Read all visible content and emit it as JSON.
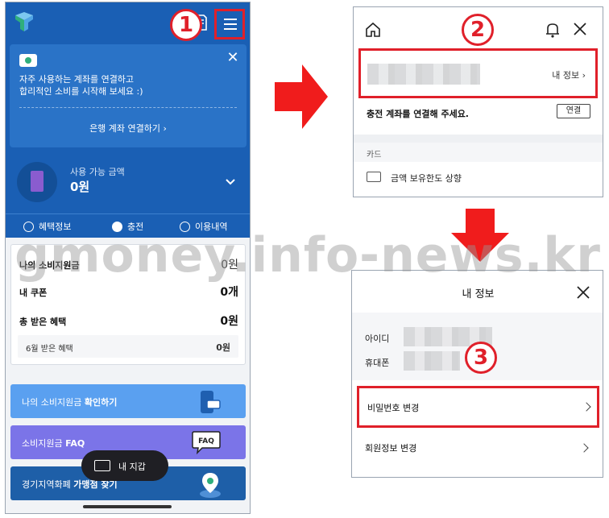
{
  "colors": {
    "brand_blue": "#1a5fb4",
    "highlight_red": "#e0202a",
    "arrow_red": "#f01c1c"
  },
  "steps": {
    "one": "1",
    "two": "2",
    "three": "3"
  },
  "left_phone": {
    "banner": {
      "line1": "자주 사용하는 계좌를 연결하고",
      "line2": "합리적인 소비를 시작해 보세요 :)",
      "link": "은행 계좌 연결하기 ›"
    },
    "balance": {
      "label": "사용 가능 금액",
      "value": "0원"
    },
    "tabs": [
      {
        "label": "혜택정보",
        "icon": "percent-icon"
      },
      {
        "label": "충전",
        "icon": "won-icon"
      },
      {
        "label": "이용내역",
        "icon": "list-icon"
      }
    ],
    "summary": [
      {
        "label": "나의 소비지원금",
        "value": "0원"
      },
      {
        "label": "내 쿠폰",
        "value": "0개"
      },
      {
        "label": "총 받은 혜택",
        "value": "0원"
      }
    ],
    "summary_sub": {
      "label": "6월 받은 혜택",
      "value": "0원"
    },
    "promos": [
      {
        "prefix": "나의 소비지원금 ",
        "bold": "확인하기",
        "color": "#5aa0f0",
        "icon": "phone-card-icon"
      },
      {
        "prefix": "소비지원금 ",
        "bold": "FAQ",
        "color": "#7b74e8",
        "icon": "faq-bubble-icon"
      },
      {
        "prefix": "경기지역화폐 ",
        "bold": "가맹점 찾기",
        "color": "#1e5fa8",
        "icon": "map-pin-icon"
      }
    ],
    "fab_label": "내 지갑",
    "faq_badge": "FAQ"
  },
  "panel2": {
    "my_info": "내 정보 ›",
    "connect_text": "충전 계좌를 연결해 주세요.",
    "connect_button": "연결",
    "section": "카드",
    "card_item": "금액 보유한도 상향"
  },
  "panel3": {
    "title": "내 정보",
    "id_label": "아이디",
    "phone_label": "휴대폰",
    "change_password": "비밀번호 변경",
    "edit_member_info": "회원정보 변경"
  },
  "watermark": "gmoney.info-news.kr"
}
